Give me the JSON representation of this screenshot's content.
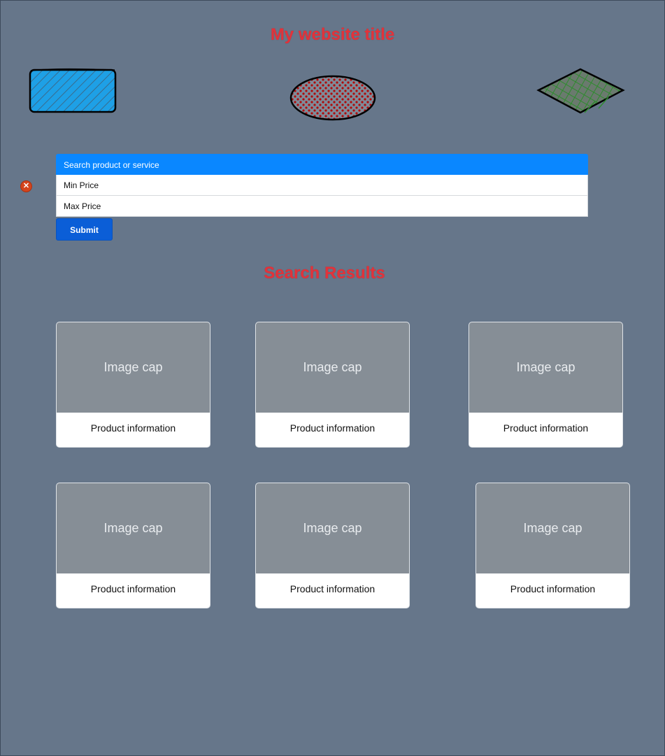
{
  "header": {
    "title": "My website title"
  },
  "search": {
    "fields": [
      "Search product or service",
      "Min Price",
      "Max Price"
    ],
    "submit_label": "Submit",
    "close_glyph": "✕"
  },
  "results": {
    "title": "Search Results",
    "cards": [
      {
        "cap": "Image cap",
        "info": "Product information"
      },
      {
        "cap": "Image cap",
        "info": "Product information"
      },
      {
        "cap": "Image cap",
        "info": "Product information"
      },
      {
        "cap": "Image cap",
        "info": "Product information"
      },
      {
        "cap": "Image cap",
        "info": "Product information"
      },
      {
        "cap": "Image cap",
        "info": "Product information"
      }
    ]
  },
  "colors": {
    "background": "#66768a",
    "title": "#e2323a",
    "primary": "#0a87ff",
    "button": "#0b5ed7",
    "shape_blue": "#1ea0e6",
    "shape_red": "#b00a0a",
    "shape_green": "#2e8b2e"
  },
  "icons": {
    "close": "close-icon"
  }
}
